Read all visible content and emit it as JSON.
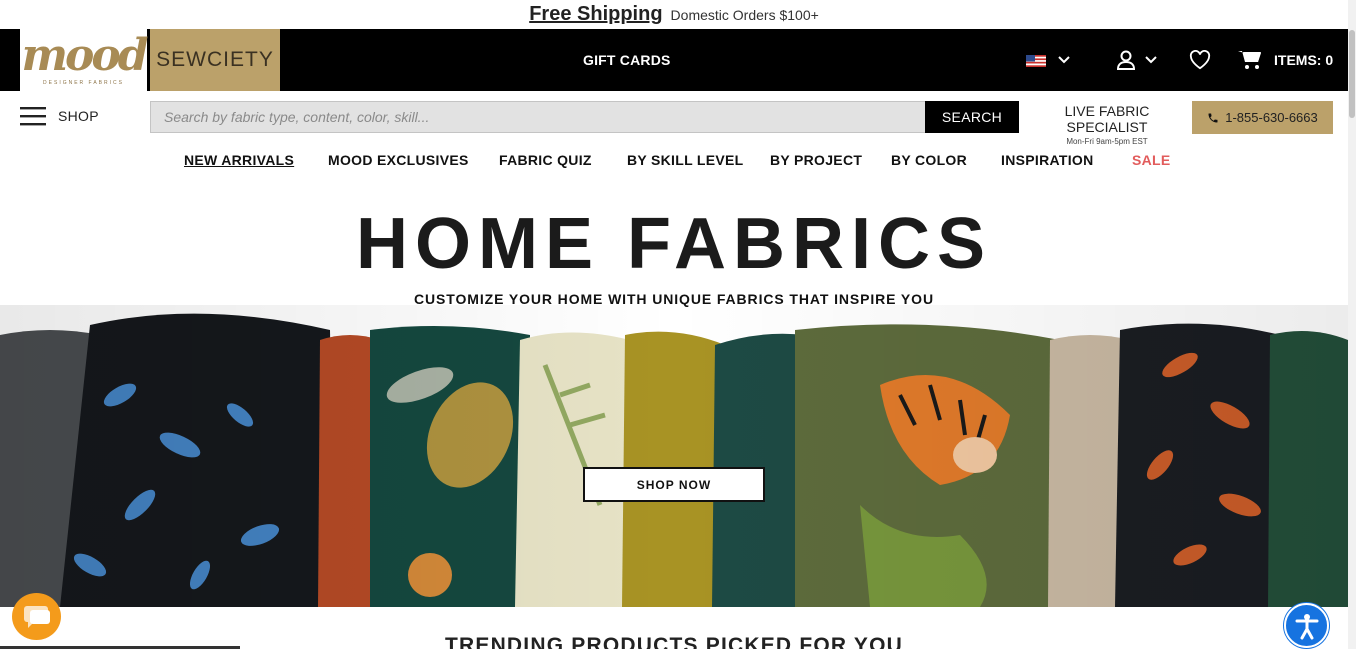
{
  "promo": {
    "headline": "Free Shipping",
    "detail": "Domestic Orders $100+"
  },
  "header": {
    "logo_main": "mood",
    "logo_sub": "DESIGNER FABRICS",
    "logo_secondary": "SEWCIETY",
    "gift_cards": "GIFT CARDS",
    "cart_label": "ITEMS: 0"
  },
  "search": {
    "menu_label": "SHOP",
    "placeholder": "Search by fabric type, content, color, skill...",
    "button": "SEARCH",
    "specialist_title": "LIVE FABRIC SPECIALIST",
    "specialist_hours": "Mon-Fri 9am-5pm EST",
    "phone": "1-855-630-6663"
  },
  "nav": {
    "items": [
      "NEW ARRIVALS",
      "MOOD EXCLUSIVES",
      "FABRIC QUIZ",
      "BY SKILL LEVEL",
      "BY PROJECT",
      "BY COLOR",
      "INSPIRATION",
      "SALE"
    ]
  },
  "hero": {
    "title": "HOME FABRICS",
    "subtitle": "CUSTOMIZE YOUR HOME WITH UNIQUE FABRICS THAT INSPIRE YOU",
    "cta": "SHOP NOW"
  },
  "trending": {
    "title": "TRENDING PRODUCTS PICKED FOR YOU"
  },
  "icons": {
    "flag": "us-flag-icon",
    "account": "user-icon",
    "wishlist": "heart-icon",
    "cart": "cart-icon",
    "chat": "chat-icon",
    "accessibility": "accessibility-icon"
  },
  "colors": {
    "brand_gold": "#bba16a",
    "header_black": "#000000",
    "sale_red": "#e25c5c",
    "chat_orange": "#f49b1b",
    "accessibility_blue": "#1673e0"
  }
}
